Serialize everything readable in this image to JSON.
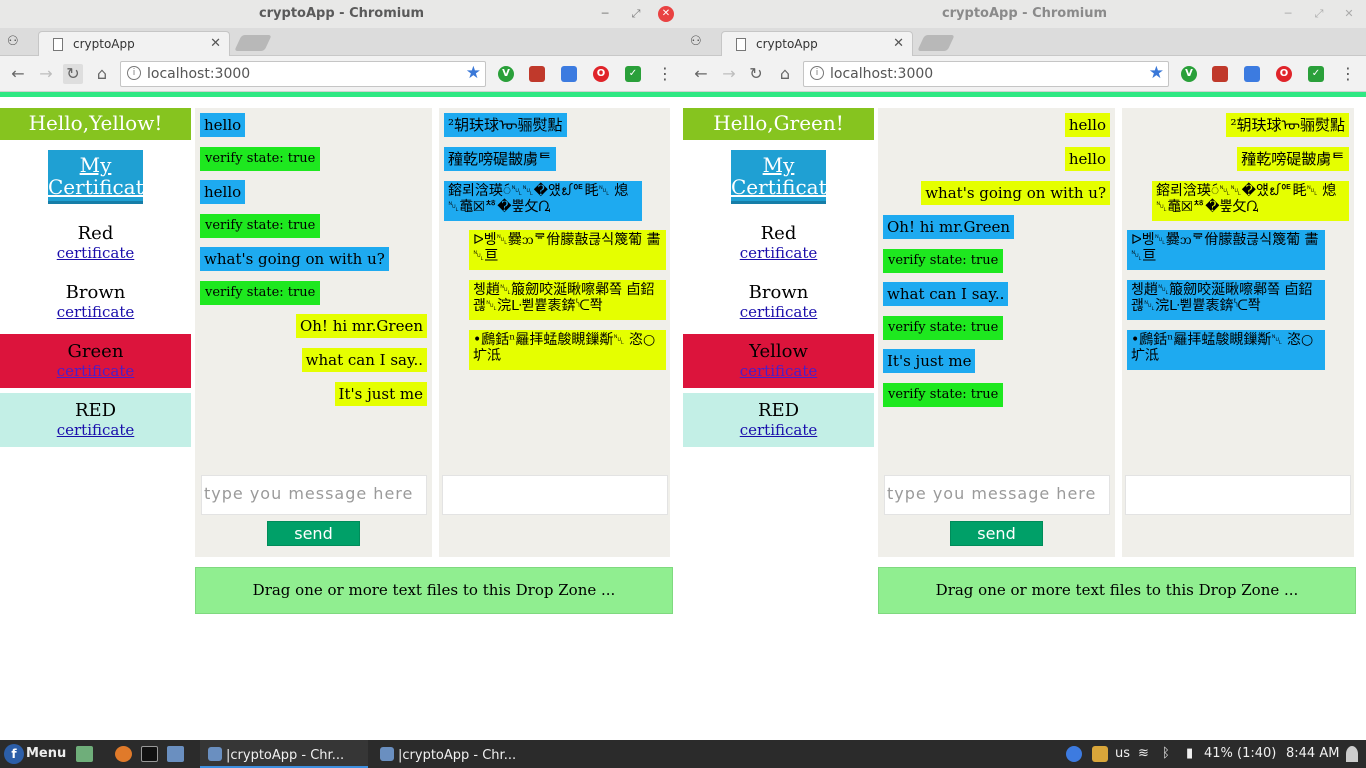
{
  "os": {
    "start_label": "Menu",
    "tasks": [
      {
        "label": "|cryptoApp - Chr..."
      },
      {
        "label": "|cryptoApp - Chr..."
      }
    ],
    "tray": {
      "keyboard": "us",
      "battery": "41% (1:40)",
      "clock": "8:44 AM"
    }
  },
  "windows": [
    {
      "title": "cryptoApp - Chromium",
      "tab_label": "cryptoApp",
      "url": "localhost:3000",
      "greeting": "Hello,Yellow!",
      "my_certificate": "My Certificate",
      "contacts": [
        {
          "name": "Red",
          "link": "certificate"
        },
        {
          "name": "Brown",
          "link": "certificate"
        },
        {
          "name": "Green",
          "link": "certificate"
        },
        {
          "name": "RED",
          "link": "certificate"
        }
      ],
      "plain_messages": [
        "hello",
        "verify state: true",
        "hello",
        "verify state: true",
        "what's going on with u?",
        "verify state: true",
        "Oh! hi mr.Green",
        "what can I say..",
        "It's just me"
      ],
      "cipher_messages": [
        "²䢁玞球ᡡ骊熨點",
        "䂌乾嗙碮皵虜ᄐ",
        "鎔뢰浛瑛ᯯ␀␀�얬᪖ᅊ眊␀ 熄␀鼁☒ᅓ�뿦攵ᘩ",
        "ᐅ벵␀爨ᦘᄛ佾朦敼큲식篾葡 畵␀亘",
        "쳉趙␀箙劒咬涎瞅嚓鄵쫔 卣鉊괞␀浣ᒷ쀧쁕袠錛ᔍ쫙",
        "•鷉銛ⁿ㒿拝蜢鵔瞡鏁斴␀ 恣○圹泜"
      ],
      "input_placeholder": "type you message here",
      "send_label": "send",
      "dropzone_label": "Drag one or more text files to this Drop Zone ..."
    },
    {
      "title": "cryptoApp - Chromium",
      "tab_label": "cryptoApp",
      "url": "localhost:3000",
      "greeting": "Hello,Green!",
      "my_certificate": "My Certificate",
      "contacts": [
        {
          "name": "Red",
          "link": "certificate"
        },
        {
          "name": "Brown",
          "link": "certificate"
        },
        {
          "name": "Yellow",
          "link": "certificate"
        },
        {
          "name": "RED",
          "link": "certificate"
        }
      ],
      "plain_messages": [
        "hello",
        "hello",
        "what's going on with u?",
        "Oh! hi mr.Green",
        "verify state: true",
        "what can I say..",
        "verify state: true",
        "It's just me",
        "verify state: true"
      ],
      "cipher_messages": [
        "²䢁玞球ᡡ骊熨點",
        "䂌乾嗙碮皵虜ᄐ",
        "鎔뢰浛瑛ᯯ␀␀�얬᪖ᅊ眊␀ 熄␀鼁☒ᅓ�뿦攵ᘩ",
        "ᐅ벵␀爨ᦘᄛ佾朦敼큲식篾葡 畵␀亘",
        "쳉趙␀箙劒咬涎瞅嚓鄵쫔 卣鉊괞␀浣ᒷ쀧쁕袠錛ᔍ쫙",
        "•鷉銛ⁿ㒿拝蜢鵔瞡鏁斴␀ 恣○圹泜"
      ],
      "input_placeholder": "type you message here",
      "send_label": "send",
      "dropzone_label": "Drag one or more text files to this Drop Zone ..."
    }
  ]
}
